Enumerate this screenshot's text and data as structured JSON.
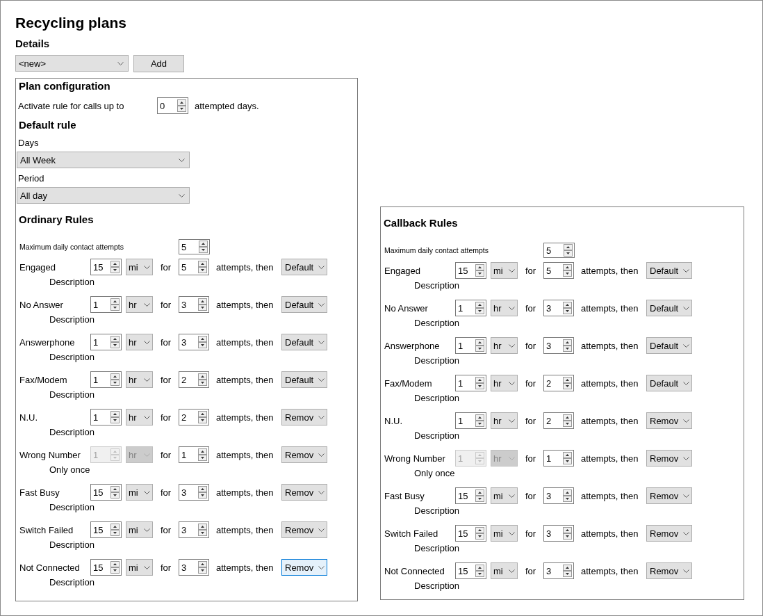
{
  "title": "Recycling plans",
  "details": {
    "heading": "Details",
    "plan_select": {
      "value": "<new>"
    },
    "add_button": "Add"
  },
  "plan_configuration": {
    "heading": "Plan configuration",
    "activate_label": "Activate rule for calls up to",
    "activate_value": "0",
    "activate_suffix": "attempted days.",
    "default_rule": {
      "heading": "Default rule",
      "days_label": "Days",
      "days_value": "All Week",
      "period_label": "Period",
      "period_value": "All day"
    }
  },
  "rule_sets": [
    {
      "heading": "Ordinary Rules",
      "max_label": "Maximum daily contact attempts",
      "max_value": "5",
      "rules": [
        {
          "label": "Engaged",
          "interval": "15",
          "unit": "mi",
          "for": "for",
          "attempts": "5",
          "then": "attempts, then",
          "action": "Default",
          "note": "Description",
          "disabled": false,
          "focused": false
        },
        {
          "label": "No Answer",
          "interval": "1",
          "unit": "hr",
          "for": "for",
          "attempts": "3",
          "then": "attempts, then",
          "action": "Default",
          "note": "Description",
          "disabled": false,
          "focused": false
        },
        {
          "label": "Answerphone",
          "interval": "1",
          "unit": "hr",
          "for": "for",
          "attempts": "3",
          "then": "attempts, then",
          "action": "Default",
          "note": "Description",
          "disabled": false,
          "focused": false
        },
        {
          "label": "Fax/Modem",
          "interval": "1",
          "unit": "hr",
          "for": "for",
          "attempts": "2",
          "then": "attempts, then",
          "action": "Default",
          "note": "Description",
          "disabled": false,
          "focused": false
        },
        {
          "label": "N.U.",
          "interval": "1",
          "unit": "hr",
          "for": "for",
          "attempts": "2",
          "then": "attempts, then",
          "action": "Remov",
          "note": "Description",
          "disabled": false,
          "focused": false
        },
        {
          "label": "Wrong Number",
          "interval": "1",
          "unit": "hr",
          "for": "for",
          "attempts": "1",
          "then": "attempts, then",
          "action": "Remov",
          "note": "Only once",
          "disabled": true,
          "focused": false
        },
        {
          "label": "Fast Busy",
          "interval": "15",
          "unit": "mi",
          "for": "for",
          "attempts": "3",
          "then": "attempts, then",
          "action": "Remov",
          "note": "Description",
          "disabled": false,
          "focused": false
        },
        {
          "label": "Switch Failed",
          "interval": "15",
          "unit": "mi",
          "for": "for",
          "attempts": "3",
          "then": "attempts, then",
          "action": "Remov",
          "note": "Description",
          "disabled": false,
          "focused": false
        },
        {
          "label": "Not Connected",
          "interval": "15",
          "unit": "mi",
          "for": "for",
          "attempts": "3",
          "then": "attempts, then",
          "action": "Remov",
          "note": "Description",
          "disabled": false,
          "focused": true
        }
      ]
    },
    {
      "heading": "Callback Rules",
      "max_label": "Maximum daily contact attempts",
      "max_value": "5",
      "rules": [
        {
          "label": "Engaged",
          "interval": "15",
          "unit": "mi",
          "for": "for",
          "attempts": "5",
          "then": "attempts, then",
          "action": "Default",
          "note": "Description",
          "disabled": false,
          "focused": false
        },
        {
          "label": "No Answer",
          "interval": "1",
          "unit": "hr",
          "for": "for",
          "attempts": "3",
          "then": "attempts, then",
          "action": "Default",
          "note": "Description",
          "disabled": false,
          "focused": false
        },
        {
          "label": "Answerphone",
          "interval": "1",
          "unit": "hr",
          "for": "for",
          "attempts": "3",
          "then": "attempts, then",
          "action": "Default",
          "note": "Description",
          "disabled": false,
          "focused": false
        },
        {
          "label": "Fax/Modem",
          "interval": "1",
          "unit": "hr",
          "for": "for",
          "attempts": "2",
          "then": "attempts, then",
          "action": "Default",
          "note": "Description",
          "disabled": false,
          "focused": false
        },
        {
          "label": "N.U.",
          "interval": "1",
          "unit": "hr",
          "for": "for",
          "attempts": "2",
          "then": "attempts, then",
          "action": "Remov",
          "note": "Description",
          "disabled": false,
          "focused": false
        },
        {
          "label": "Wrong Number",
          "interval": "1",
          "unit": "hr",
          "for": "for",
          "attempts": "1",
          "then": "attempts, then",
          "action": "Remov",
          "note": "Only once",
          "disabled": true,
          "focused": false
        },
        {
          "label": "Fast Busy",
          "interval": "15",
          "unit": "mi",
          "for": "for",
          "attempts": "3",
          "then": "attempts, then",
          "action": "Remov",
          "note": "Description",
          "disabled": false,
          "focused": false
        },
        {
          "label": "Switch Failed",
          "interval": "15",
          "unit": "mi",
          "for": "for",
          "attempts": "3",
          "then": "attempts, then",
          "action": "Remov",
          "note": "Description",
          "disabled": false,
          "focused": false
        },
        {
          "label": "Not Connected",
          "interval": "15",
          "unit": "mi",
          "for": "for",
          "attempts": "3",
          "then": "attempts, then",
          "action": "Remov",
          "note": "Description",
          "disabled": false,
          "focused": false
        }
      ]
    }
  ]
}
